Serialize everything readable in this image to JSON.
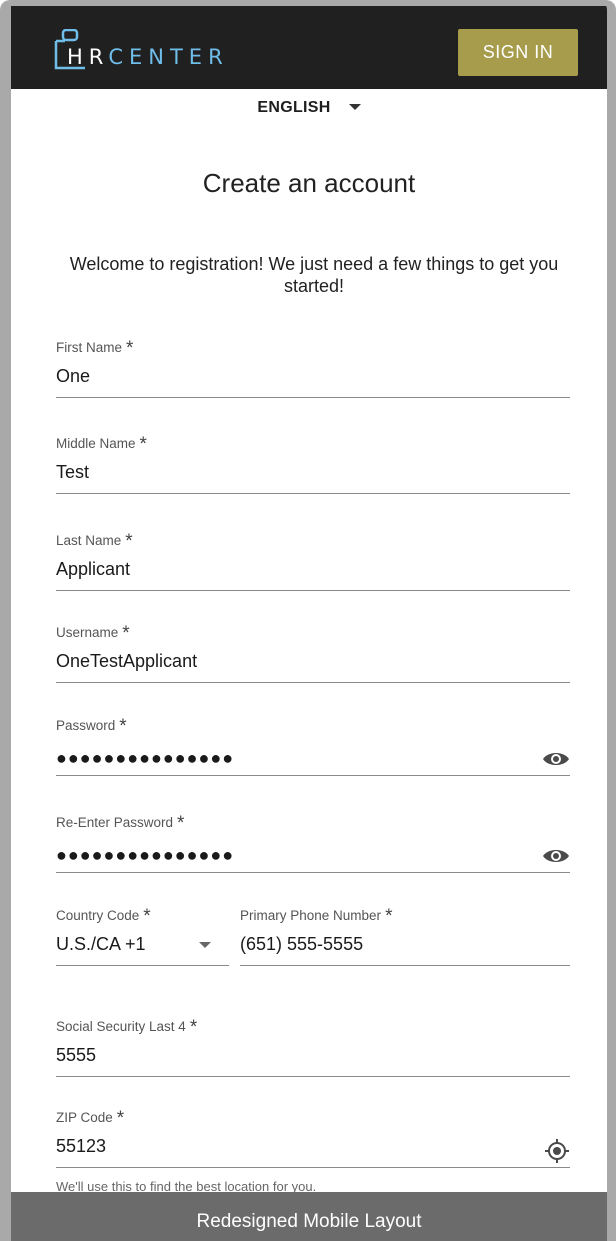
{
  "header": {
    "logo_hr": "HR",
    "logo_center": "CENTER",
    "signin_label": "SIGN IN"
  },
  "language": {
    "selected": "ENGLISH"
  },
  "title": "Create an account",
  "welcome": "Welcome to registration! We just need a few things to get you started!",
  "form": {
    "first_name": {
      "label": "First Name",
      "required": "*",
      "value": "One"
    },
    "middle_name": {
      "label": "Middle Name",
      "required": "*",
      "value": "Test"
    },
    "last_name": {
      "label": "Last Name",
      "required": "*",
      "value": "Applicant"
    },
    "username": {
      "label": "Username",
      "required": "*",
      "value": "OneTestApplicant"
    },
    "password": {
      "label": "Password",
      "required": "*",
      "value": "●●●●●●●●●●●●●●●"
    },
    "reenter_password": {
      "label": "Re-Enter Password",
      "required": "*",
      "value": "●●●●●●●●●●●●●●●"
    },
    "country_code": {
      "label": "Country Code",
      "required": "*",
      "value": "U.S./CA +1"
    },
    "phone": {
      "label": "Primary Phone Number",
      "required": "*",
      "value": "(651) 555-5555"
    },
    "ssn_last4": {
      "label": "Social Security Last 4",
      "required": "*",
      "value": "5555"
    },
    "zip": {
      "label": "ZIP Code",
      "required": "*",
      "value": "55123",
      "hint": "We'll use this to find the best location for you."
    }
  },
  "footer": {
    "label": "Redesigned Mobile Layout"
  },
  "colors": {
    "topbar": "#202020",
    "signin": "#a79b4c",
    "logo_accent": "#6fbde9",
    "footer": "#6b6b6b"
  }
}
